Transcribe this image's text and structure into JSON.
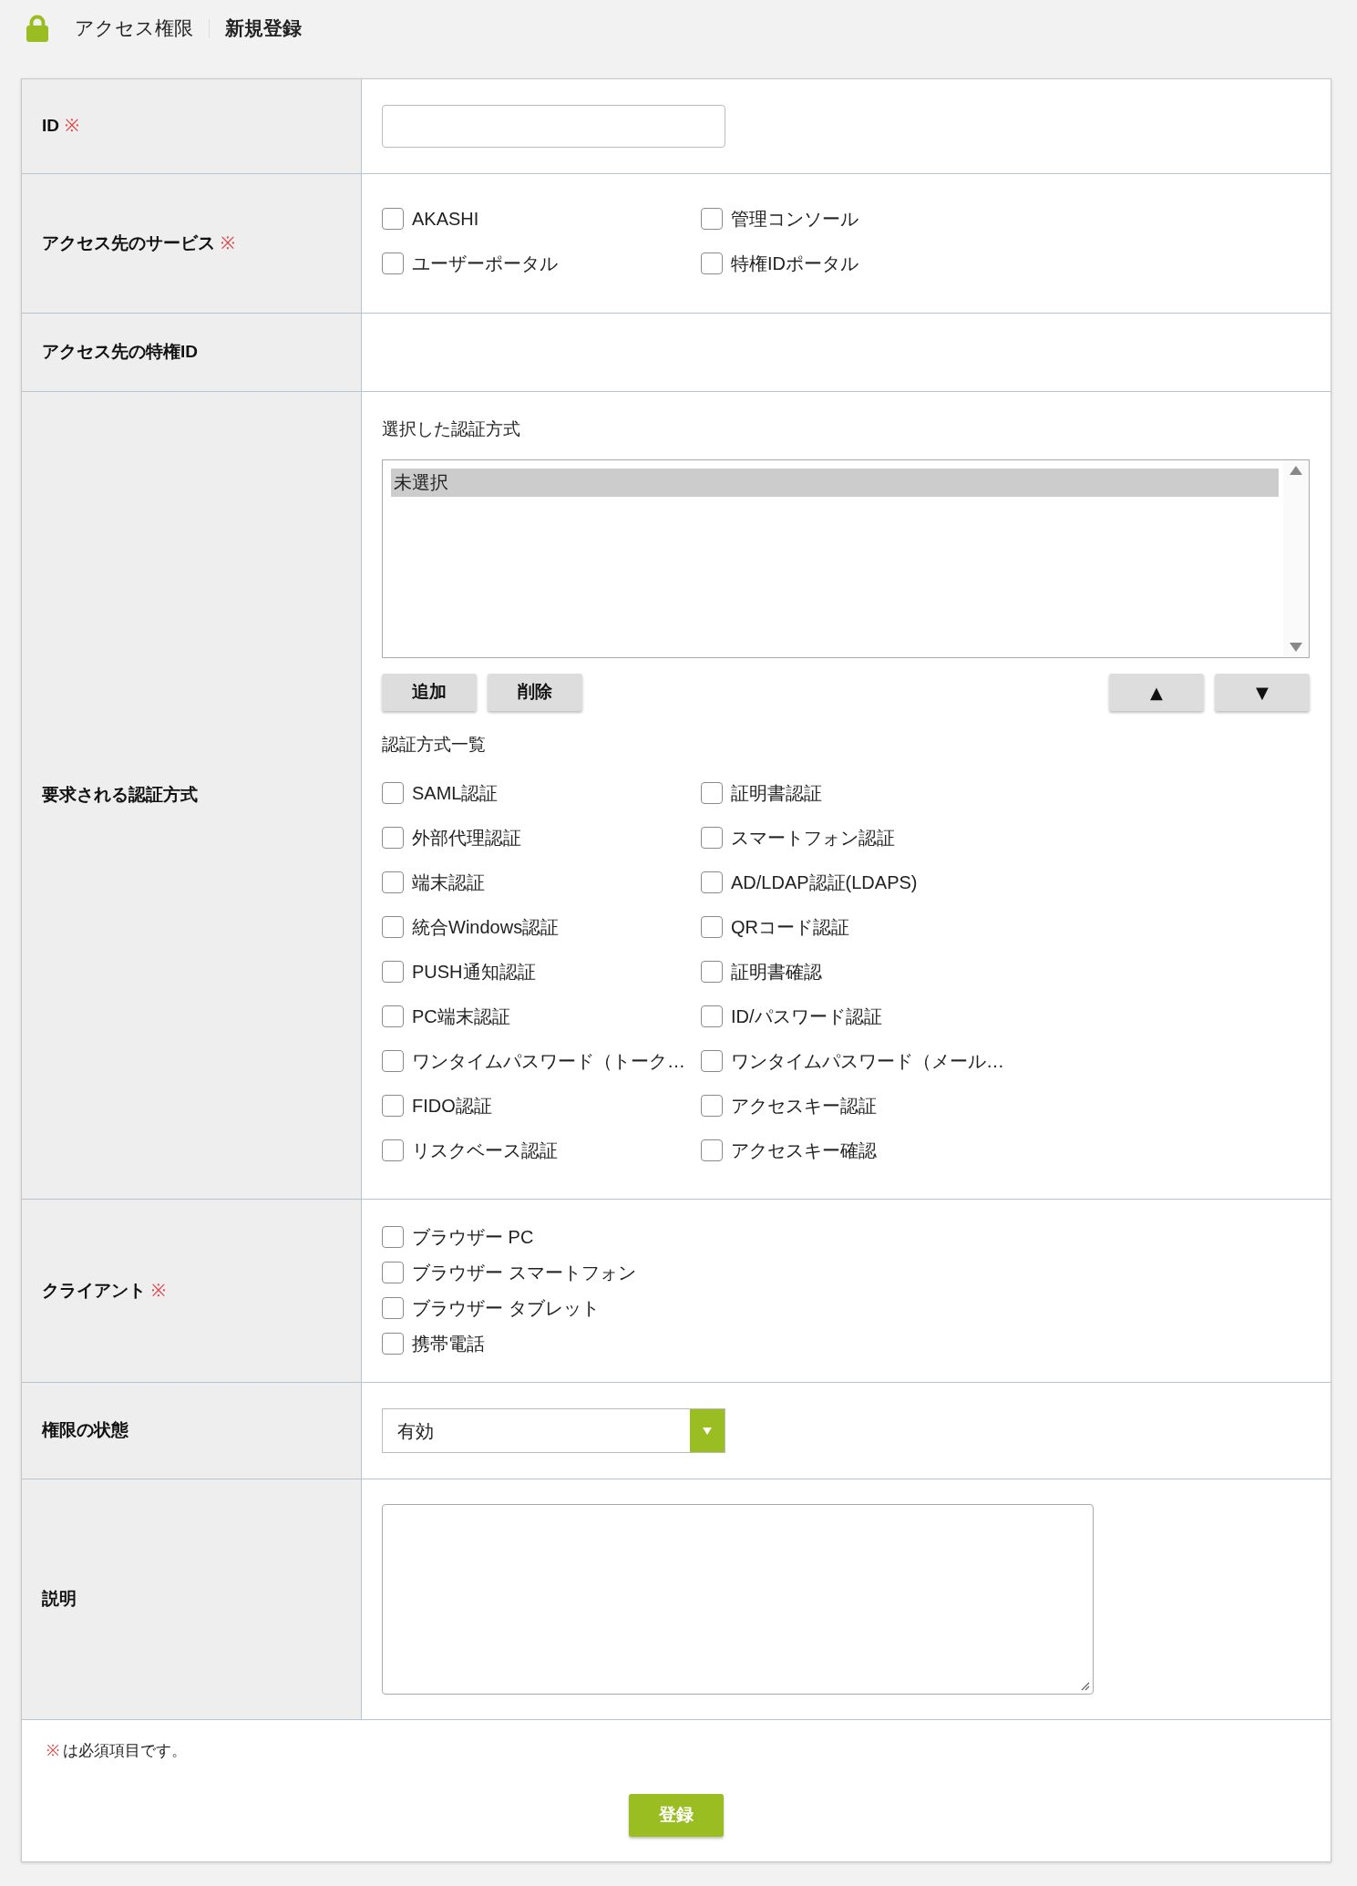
{
  "header": {
    "title": "アクセス権限",
    "subtitle": "新規登録"
  },
  "rows": [
    {
      "kind": "text_input",
      "label": "ID",
      "mark": "※"
    },
    {
      "kind": "checkbox_grid",
      "label": "アクセス先のサービス",
      "mark": "※",
      "options": [
        {
          "label": "AKASHI",
          "checked": false
        },
        {
          "label": "管理コンソール",
          "checked": false
        },
        {
          "label": "ユーザーポータル",
          "checked": false
        },
        {
          "label": "特権IDポータル",
          "checked": false
        }
      ]
    },
    {
      "kind": "empty",
      "label": "アクセス先の特権ID"
    },
    {
      "kind": "auth_methods",
      "label": "要求される認証方式",
      "selected_heading": "選択した認証方式",
      "selected_list": [
        {
          "label": "未選択",
          "selected": true
        }
      ],
      "buttons": [
        {
          "label": "追加"
        },
        {
          "label": "削除"
        }
      ],
      "order_buttons": [
        {
          "label": "▲"
        },
        {
          "label": "▼"
        }
      ],
      "list_heading": "認証方式一覧",
      "options": [
        {
          "label": "SAML認証",
          "checked": false
        },
        {
          "label": "証明書認証",
          "checked": false
        },
        {
          "label": "外部代理認証",
          "checked": false
        },
        {
          "label": "スマートフォン認証",
          "checked": false
        },
        {
          "label": "端末認証",
          "checked": false
        },
        {
          "label": "AD/LDAP認証(LDAPS)",
          "checked": false
        },
        {
          "label": "統合Windows認証",
          "checked": false
        },
        {
          "label": "QRコード認証",
          "checked": false
        },
        {
          "label": "PUSH通知認証",
          "checked": false
        },
        {
          "label": "証明書確認",
          "checked": false
        },
        {
          "label": "PC端末認証",
          "checked": false
        },
        {
          "label": "ID/パスワード認証",
          "checked": false
        },
        {
          "label": "ワンタイムパスワード（トーク…",
          "checked": false
        },
        {
          "label": "ワンタイムパスワード（メール…",
          "checked": false
        },
        {
          "label": "FIDO認証",
          "checked": false
        },
        {
          "label": "アクセスキー認証",
          "checked": false
        },
        {
          "label": "リスクベース認証",
          "checked": false
        },
        {
          "label": "アクセスキー確認",
          "checked": false
        }
      ]
    },
    {
      "kind": "checkbox_stack",
      "label": "クライアント",
      "mark": "※",
      "options": [
        {
          "label": "ブラウザー PC",
          "checked": false
        },
        {
          "label": "ブラウザー スマートフォン",
          "checked": false
        },
        {
          "label": "ブラウザー タブレット",
          "checked": false
        },
        {
          "label": "携帯電話",
          "checked": false
        }
      ]
    },
    {
      "kind": "select",
      "label": "権限の状態",
      "value": "有効"
    },
    {
      "kind": "textarea",
      "label": "説明"
    }
  ],
  "footer": {
    "mark": "※",
    "note": "は必須項目です。",
    "submit": "登録"
  }
}
